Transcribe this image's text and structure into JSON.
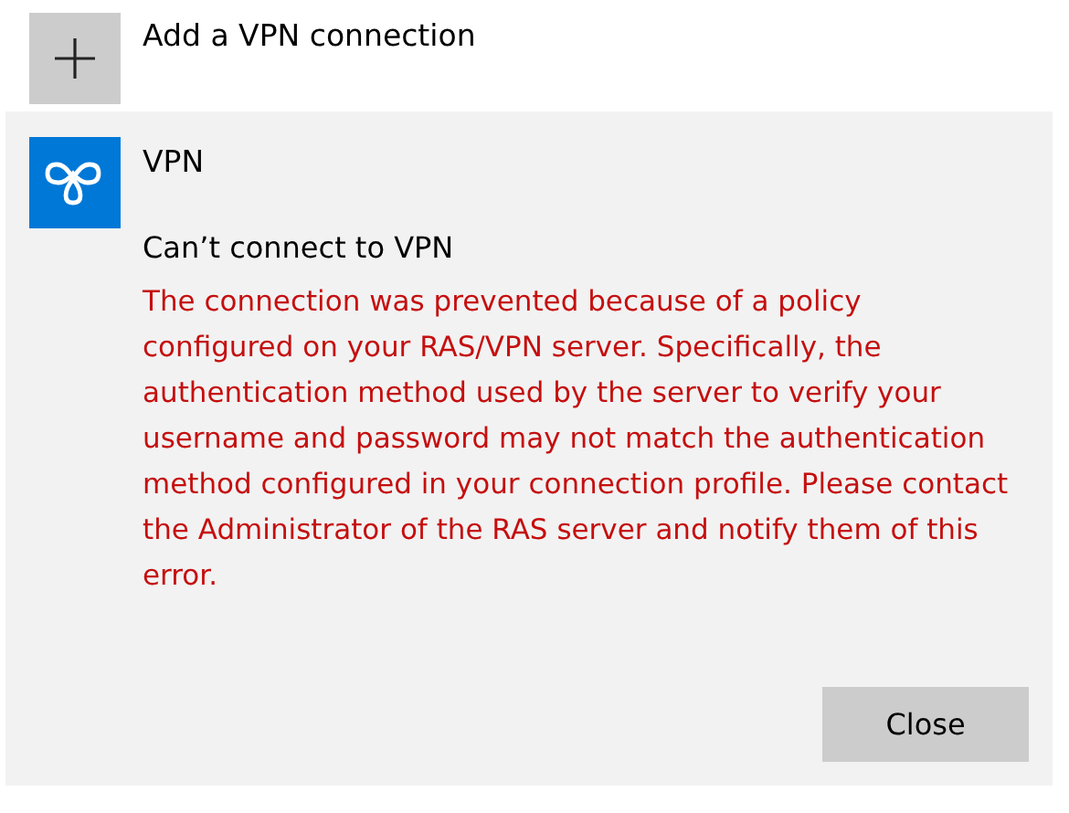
{
  "add_connection": {
    "label": "Add a VPN connection"
  },
  "connection": {
    "name": "VPN",
    "error_title": "Can’t connect to VPN",
    "error_message": "The connection was prevented because of a policy configured on your RAS/VPN server. Specifically, the authentication method used by the server to verify your username and password may not match the authentication method configured in your connection profile. Please contact the Administrator of the RAS server and notify them of this error.",
    "buttons": [
      "Close"
    ]
  }
}
